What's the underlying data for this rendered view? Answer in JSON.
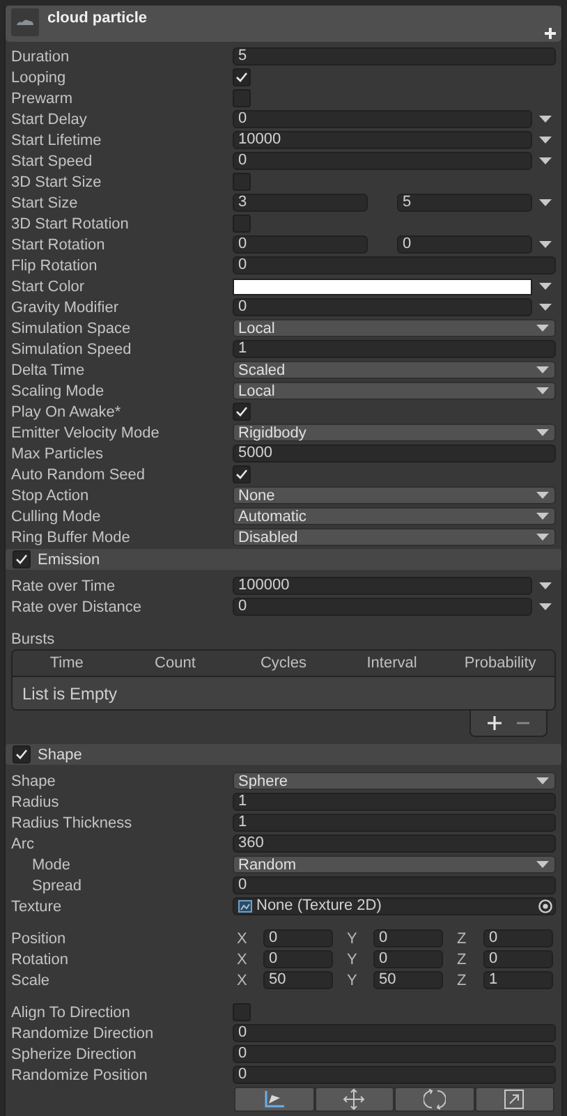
{
  "component": {
    "title": "cloud particle"
  },
  "main": {
    "rows": [
      {
        "label": "Duration",
        "kind": "number",
        "value": "5"
      },
      {
        "label": "Looping",
        "kind": "check",
        "checked": true
      },
      {
        "label": "Prewarm",
        "kind": "check",
        "checked": false
      },
      {
        "label": "Start Delay",
        "kind": "curve",
        "value": "0"
      },
      {
        "label": "Start Lifetime",
        "kind": "curve",
        "value": "10000"
      },
      {
        "label": "Start Speed",
        "kind": "curve",
        "value": "0"
      },
      {
        "label": "3D Start Size",
        "kind": "check",
        "checked": false
      },
      {
        "label": "Start Size",
        "kind": "range",
        "values": [
          "3",
          "5"
        ]
      },
      {
        "label": "3D Start Rotation",
        "kind": "check",
        "checked": false
      },
      {
        "label": "Start Rotation",
        "kind": "range",
        "values": [
          "0",
          "0"
        ]
      },
      {
        "label": "Flip Rotation",
        "kind": "number",
        "value": "0"
      },
      {
        "label": "Start Color",
        "kind": "color",
        "color": "#ffffff"
      },
      {
        "label": "Gravity Modifier",
        "kind": "curve",
        "value": "0"
      },
      {
        "label": "Simulation Space",
        "kind": "dropdown",
        "value": "Local"
      },
      {
        "label": "Simulation Speed",
        "kind": "number",
        "value": "1"
      },
      {
        "label": "Delta Time",
        "kind": "dropdown",
        "value": "Scaled"
      },
      {
        "label": "Scaling Mode",
        "kind": "dropdown",
        "value": "Local"
      },
      {
        "label": "Play On Awake*",
        "kind": "check",
        "checked": true
      },
      {
        "label": "Emitter Velocity Mode",
        "kind": "dropdown",
        "value": "Rigidbody"
      },
      {
        "label": "Max Particles",
        "kind": "number",
        "value": "5000"
      },
      {
        "label": "Auto Random Seed",
        "kind": "check",
        "checked": true
      },
      {
        "label": "Stop Action",
        "kind": "dropdown",
        "value": "None"
      },
      {
        "label": "Culling Mode",
        "kind": "dropdown",
        "value": "Automatic"
      },
      {
        "label": "Ring Buffer Mode",
        "kind": "dropdown",
        "value": "Disabled"
      }
    ]
  },
  "emission": {
    "title": "Emission",
    "enabled": true,
    "rows": [
      {
        "label": "Rate over Time",
        "kind": "curve",
        "value": "100000"
      },
      {
        "label": "Rate over Distance",
        "kind": "curve",
        "value": "0"
      }
    ],
    "bursts": {
      "label": "Bursts",
      "columns": [
        "Time",
        "Count",
        "Cycles",
        "Interval",
        "Probability"
      ],
      "empty_text": "List is Empty"
    }
  },
  "shape": {
    "title": "Shape",
    "enabled": true,
    "rows": [
      {
        "label": "Shape",
        "kind": "dropdown",
        "value": "Sphere"
      },
      {
        "label": "Radius",
        "kind": "number",
        "value": "1"
      },
      {
        "label": "Radius Thickness",
        "kind": "number",
        "value": "1"
      },
      {
        "label": "Arc",
        "kind": "number",
        "value": "360",
        "children": [
          {
            "label": "Mode",
            "kind": "dropdown",
            "value": "Random"
          },
          {
            "label": "Spread",
            "kind": "number",
            "value": "0"
          }
        ]
      },
      {
        "label": "Texture",
        "kind": "texture",
        "value": "None (Texture 2D)"
      }
    ],
    "transform_rows": [
      {
        "label": "Position",
        "kind": "vector3",
        "axes": [
          {
            "axis": "X",
            "value": "0"
          },
          {
            "axis": "Y",
            "value": "0"
          },
          {
            "axis": "Z",
            "value": "0"
          }
        ]
      },
      {
        "label": "Rotation",
        "kind": "vector3",
        "axes": [
          {
            "axis": "X",
            "value": "0"
          },
          {
            "axis": "Y",
            "value": "0"
          },
          {
            "axis": "Z",
            "value": "0"
          }
        ]
      },
      {
        "label": "Scale",
        "kind": "vector3",
        "axes": [
          {
            "axis": "X",
            "value": "50"
          },
          {
            "axis": "Y",
            "value": "50"
          },
          {
            "axis": "Z",
            "value": "1"
          }
        ]
      }
    ],
    "direction_rows": [
      {
        "label": "Align To Direction",
        "kind": "check",
        "checked": false
      },
      {
        "label": "Randomize Direction",
        "kind": "number",
        "value": "0"
      },
      {
        "label": "Spherize Direction",
        "kind": "number",
        "value": "0"
      },
      {
        "label": "Randomize Position",
        "kind": "number",
        "value": "0"
      }
    ]
  }
}
